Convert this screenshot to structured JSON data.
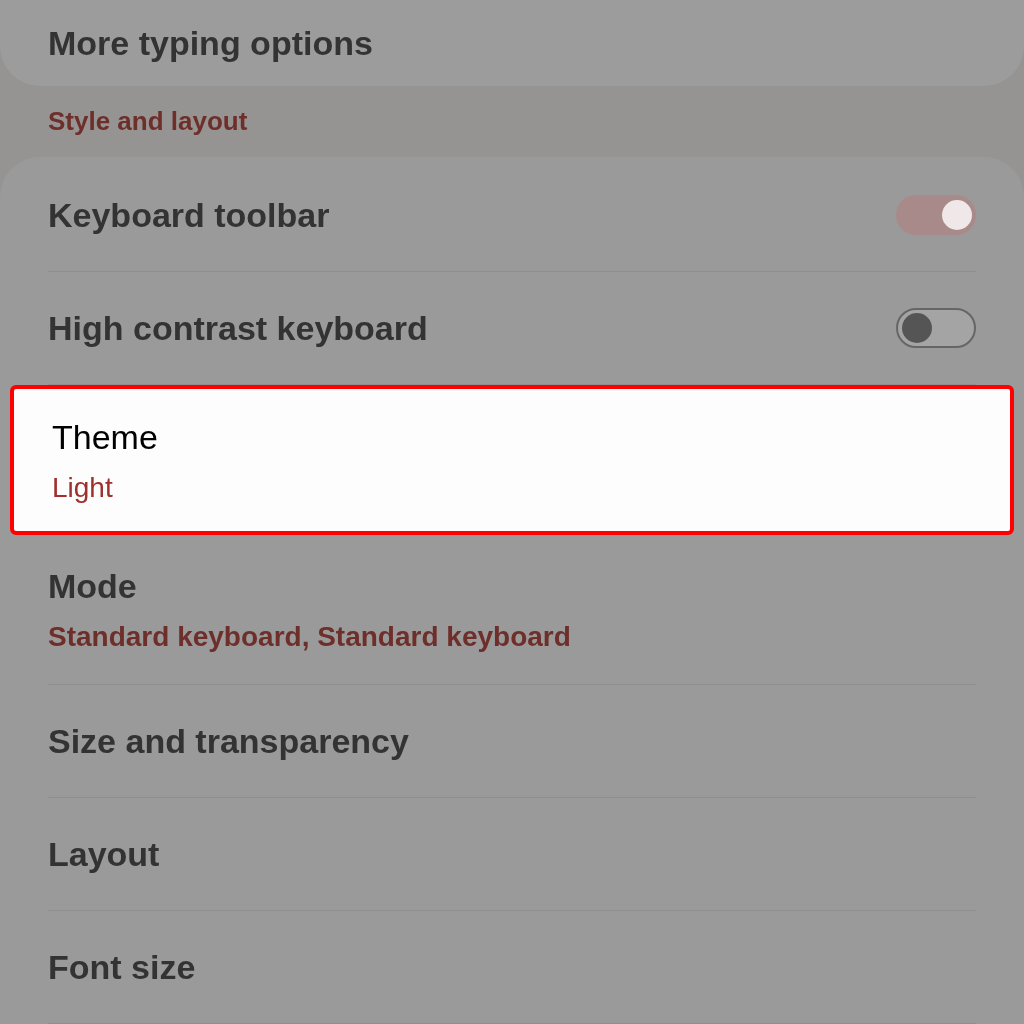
{
  "top_item": {
    "title": "More typing options"
  },
  "section": {
    "title": "Style and layout"
  },
  "items": [
    {
      "kind": "toggle",
      "title": "Keyboard toolbar",
      "on": true,
      "highlighted": false
    },
    {
      "kind": "toggle",
      "title": "High contrast keyboard",
      "on": false,
      "highlighted": false
    },
    {
      "kind": "value",
      "title": "Theme",
      "value": "Light",
      "highlighted": true
    },
    {
      "kind": "value",
      "title": "Mode",
      "value": "Standard keyboard, Standard keyboard",
      "highlighted": false
    },
    {
      "kind": "plain",
      "title": "Size and transparency",
      "highlighted": false
    },
    {
      "kind": "plain",
      "title": "Layout",
      "highlighted": false
    },
    {
      "kind": "plain",
      "title": "Font size",
      "highlighted": false
    }
  ]
}
